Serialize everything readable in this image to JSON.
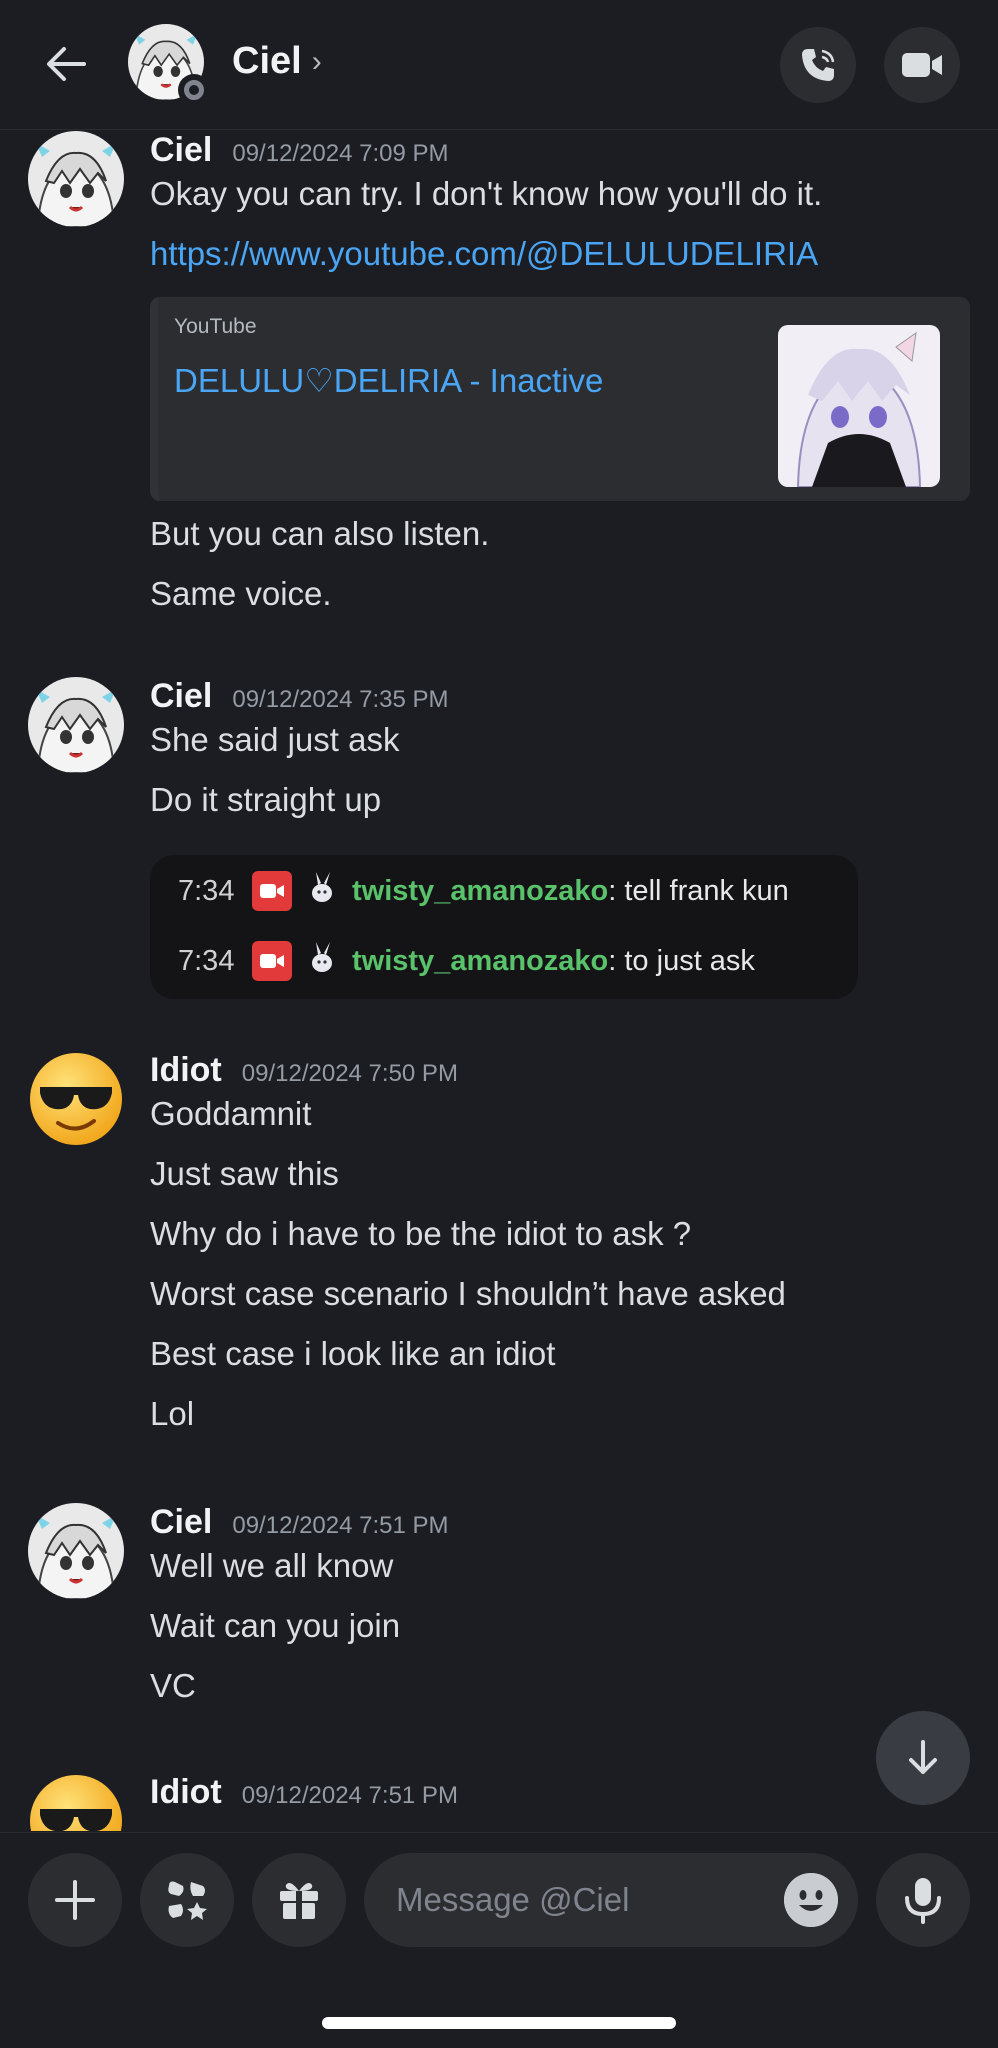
{
  "header": {
    "name": "Ciel",
    "chevron": "›",
    "icons": {
      "back": "arrow-left-icon",
      "call": "phone-icon",
      "video": "video-camera-icon"
    }
  },
  "messages": [
    {
      "author": "Ciel",
      "timestamp": "09/12/2024 7:09 PM",
      "lines": [
        "Okay you can try. I don't know how you'll do it."
      ],
      "link": "https://www.youtube.com/@DELULUDELIRIA",
      "embed": {
        "provider": "YouTube",
        "title": "DELULU♡DELIRIA - Inactive"
      },
      "after_lines": [
        "But you can also listen.",
        "Same voice."
      ]
    },
    {
      "author": "Ciel",
      "timestamp": "09/12/2024 7:35 PM",
      "lines": [
        "She said just ask",
        "Do it straight up"
      ],
      "clip": [
        {
          "time": "7:34",
          "user": "twisty_amanozako",
          "text": ": tell frank kun"
        },
        {
          "time": "7:34",
          "user": "twisty_amanozako",
          "text": ": to just ask"
        }
      ]
    },
    {
      "author": "Idiot",
      "timestamp": "09/12/2024 7:50 PM",
      "lines": [
        "Goddamnit",
        "Just saw this",
        "Why do i have to be the idiot to ask ?",
        "Worst case scenario I shouldn’t have asked",
        "Best case i look like an idiot",
        "Lol"
      ]
    },
    {
      "author": "Ciel",
      "timestamp": "09/12/2024 7:51 PM",
      "lines": [
        "Well we all know",
        "Wait can you join",
        "VC"
      ]
    },
    {
      "author": "Idiot",
      "timestamp": "09/12/2024 7:51 PM",
      "lines": []
    }
  ],
  "composer": {
    "placeholder": "Message @Ciel",
    "icons": {
      "add": "plus-icon",
      "apps": "apps-icon",
      "gift": "gift-icon",
      "emoji": "emoji-icon",
      "mic": "microphone-icon"
    }
  },
  "colors": {
    "background": "#1c1d22",
    "link": "#4aa6f5",
    "username_chat": "#59c26a",
    "panel": "#2b2d31"
  }
}
